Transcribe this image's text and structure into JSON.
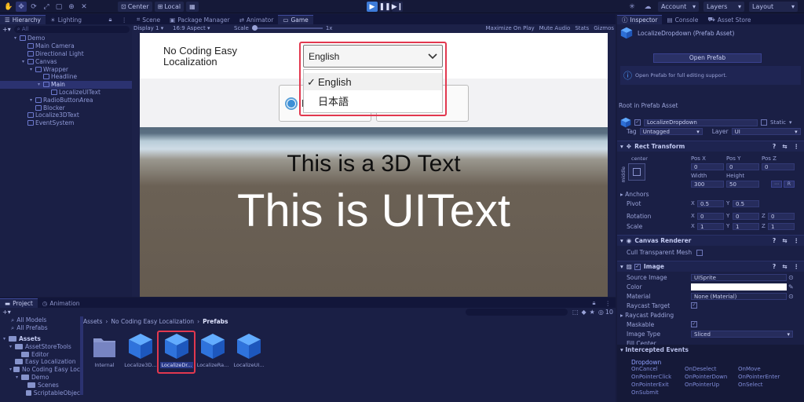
{
  "toolbar": {
    "center_label": "Center",
    "local_label": "Local",
    "account_label": "Account",
    "layers_label": "Layers",
    "layout_label": "Layout",
    "tool_icons": [
      "hand-icon",
      "move-icon",
      "rotate-icon",
      "scale-icon",
      "rect-icon",
      "transform-icon",
      "custom-tool-icon"
    ]
  },
  "hierarchy": {
    "tab_label": "Hierarchy",
    "tab2_label": "Lighting",
    "search_placeholder": "All",
    "items": [
      {
        "label": "Demo",
        "depth": 0
      },
      {
        "label": "Main Camera",
        "depth": 1
      },
      {
        "label": "Directional Light",
        "depth": 1
      },
      {
        "label": "Canvas",
        "depth": 1
      },
      {
        "label": "Wrapper",
        "depth": 2
      },
      {
        "label": "Headline",
        "depth": 3
      },
      {
        "label": "Main",
        "depth": 3
      },
      {
        "label": "LocalizeUIText",
        "depth": 4
      },
      {
        "label": "RadioButtonArea",
        "depth": 2
      },
      {
        "label": "Blocker",
        "depth": 2
      },
      {
        "label": "Localize3DText",
        "depth": 1
      },
      {
        "label": "EventSystem",
        "depth": 1
      }
    ]
  },
  "center_tabs": {
    "scene": "Scene",
    "package_manager": "Package Manager",
    "animator": "Animator",
    "game": "Game"
  },
  "game_bar": {
    "display": "Display 1",
    "aspect": "16:9 Aspect",
    "scale_label": "Scale",
    "scale_value": "1x",
    "maximize": "Maximize On Play",
    "mute": "Mute Audio",
    "stats": "Stats",
    "gizmos": "Gizmos"
  },
  "game": {
    "headline_line1": "No Coding Easy",
    "headline_line2": "Localization",
    "dropdown_value": "English",
    "options": [
      "English",
      "日本語"
    ],
    "selected_check": "✓",
    "radio_partial": "E",
    "text_3d": "This is a 3D Text",
    "text_ui": "This is UIText"
  },
  "project": {
    "tab_label": "Project",
    "tab2_label": "Animation",
    "favorites": [
      "All Models",
      "All Prefabs"
    ],
    "tree": [
      {
        "label": "Assets",
        "depth": 0
      },
      {
        "label": "AssetStoreTools",
        "depth": 1
      },
      {
        "label": "Editor",
        "depth": 2
      },
      {
        "label": "Easy Localization",
        "depth": 1
      },
      {
        "label": "No Coding Easy Loc",
        "depth": 1
      },
      {
        "label": "Demo",
        "depth": 2
      },
      {
        "label": "Scenes",
        "depth": 3
      },
      {
        "label": "ScriptableObjec",
        "depth": 3
      }
    ],
    "breadcrumb": [
      "Assets",
      "No Coding Easy Localization",
      "Prefabs"
    ],
    "count_label": "10",
    "assets": [
      "Internal",
      "Localize3D...",
      "LocalizeDr...",
      "LocalizeRa...",
      "LocalizeUI..."
    ]
  },
  "inspector": {
    "tab_label": "Inspector",
    "tab2_label": "Console",
    "tab3_label": "Asset Store",
    "title": "LocalizeDropdown (Prefab Asset)",
    "open_prefab": "Open Prefab",
    "info": "Open Prefab for full editing support.",
    "root_label": "Root in Prefab Asset",
    "object_name": "LocalizeDropdown",
    "static_label": "Static",
    "tag_label": "Tag",
    "tag_value": "Untagged",
    "layer_label": "Layer",
    "layer_value": "UI",
    "rect_transform": "Rect Transform",
    "anchor_mode": "center",
    "middle_label": "middle",
    "pos_headers": [
      "Pos X",
      "Pos Y",
      "Pos Z"
    ],
    "pos_values": [
      "0",
      "0",
      "0"
    ],
    "size_headers": [
      "Width",
      "Height"
    ],
    "size_values": [
      "300",
      "50"
    ],
    "anchors_label": "Anchors",
    "pivot_label": "Pivot",
    "pivot": [
      "0.5",
      "0.5"
    ],
    "rotation_label": "Rotation",
    "rotation": [
      "0",
      "0",
      "0"
    ],
    "scale_label": "Scale",
    "scale": [
      "1",
      "1",
      "1"
    ],
    "axis_x": "X",
    "axis_y": "Y",
    "axis_z": "Z",
    "canvas_renderer": "Canvas Renderer",
    "cull_label": "Cull Transparent Mesh",
    "image_label": "Image",
    "source_image_label": "Source Image",
    "source_image_value": "UISprite",
    "color_label": "Color",
    "material_label": "Material",
    "material_value": "None (Material)",
    "raycast_target": "Raycast Target",
    "raycast_padding": "Raycast Padding",
    "maskable": "Maskable",
    "image_type_label": "Image Type",
    "image_type_value": "Sliced",
    "fill_center": "Fill Center",
    "intercepted_events": "Intercepted Events",
    "events_component": "Dropdown",
    "events": [
      "OnCancel",
      "OnDeselect",
      "OnMove",
      "OnPointerClick",
      "OnPointerDown",
      "OnPointerEnter",
      "OnPointerExit",
      "OnPointerUp",
      "OnSelect",
      "OnSubmit"
    ]
  },
  "colors": {
    "accent": "#3d7bd9",
    "highlight_red": "#e2384f",
    "panel": "#1a1f45"
  }
}
